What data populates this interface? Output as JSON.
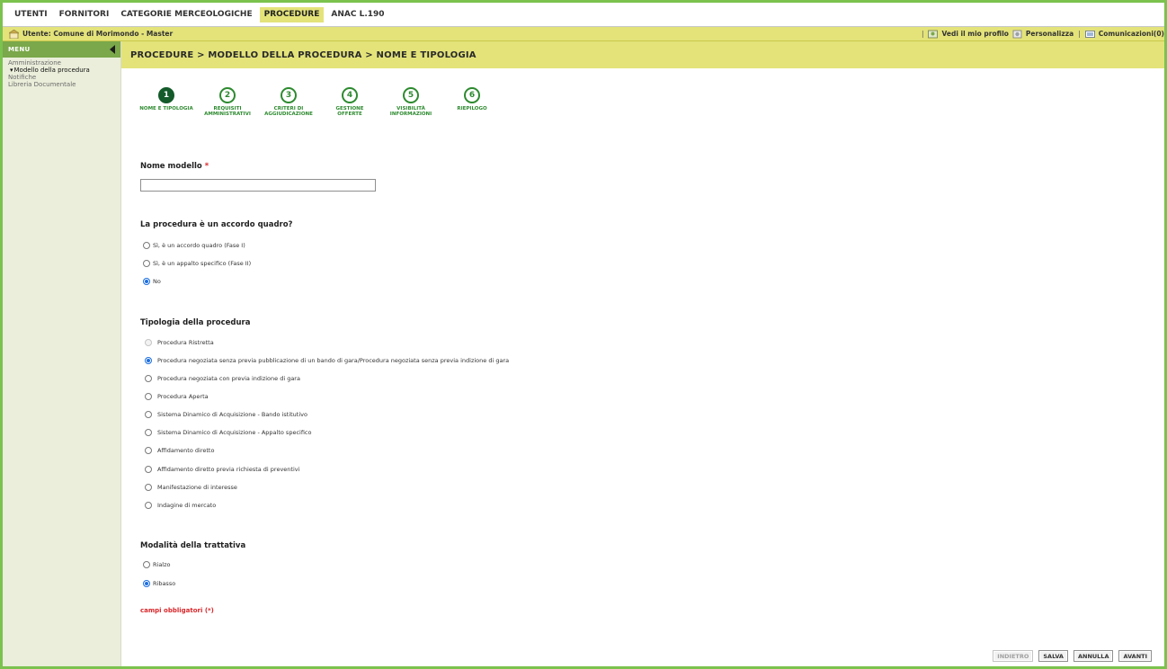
{
  "tabs": [
    {
      "label": "UTENTI",
      "active": false
    },
    {
      "label": "FORNITORI",
      "active": false
    },
    {
      "label": "CATEGORIE MERCEOLOGICHE",
      "active": false
    },
    {
      "label": "PROCEDURE",
      "active": true
    },
    {
      "label": "ANAC L.190",
      "active": false
    }
  ],
  "userbar": {
    "user_label": "Utente: Comune di Morimondo - Master",
    "profile_link": "Vedi il mio profilo",
    "customize_link": "Personalizza",
    "messages_link": "Comunicazioni(0)"
  },
  "sidebar": {
    "title": "MENU",
    "items": [
      {
        "label": "Amministrazione"
      },
      {
        "label": "Modello della procedura"
      },
      {
        "label": "Notifiche"
      },
      {
        "label": "Libreria Documentale"
      }
    ]
  },
  "breadcrumb": "PROCEDURE  > MODELLO DELLA PROCEDURA  > NOME E TIPOLOGIA",
  "steps": [
    {
      "num": "1",
      "label": "NOME E TIPOLOGIA",
      "active": true
    },
    {
      "num": "2",
      "label": "REQUISITI\nAMMINISTRATIVI",
      "active": false
    },
    {
      "num": "3",
      "label": "CRITERI DI\nAGGIUDICAZIONE",
      "active": false
    },
    {
      "num": "4",
      "label": "GESTIONE\nOFFERTE",
      "active": false
    },
    {
      "num": "5",
      "label": "VISIBILITÀ\nINFORMAZIONI",
      "active": false
    },
    {
      "num": "6",
      "label": "RIEPILOGO",
      "active": false
    }
  ],
  "form": {
    "name_label": "Nome modello",
    "required_mark": "*",
    "name_value": "",
    "framework_question": "La procedura è un accordo quadro?",
    "framework_options": [
      {
        "label": "Sì, è un accordo quadro (Fase I)",
        "selected": false
      },
      {
        "label": "Sì, è un appalto specifico (Fase II)",
        "selected": false
      },
      {
        "label": "No",
        "selected": true
      }
    ],
    "type_title": "Tipologia della procedura",
    "type_options": [
      {
        "label": "Procedura Ristretta",
        "selected": false,
        "disabled": true
      },
      {
        "label": "Procedura negoziata senza previa pubblicazione di un bando di gara/Procedura negoziata senza previa indizione di gara",
        "selected": true,
        "disabled": false
      },
      {
        "label": "Procedura negoziata con previa indizione di gara",
        "selected": false,
        "disabled": false
      },
      {
        "label": "Procedura Aperta",
        "selected": false,
        "disabled": false
      },
      {
        "label": "Sistema Dinamico di Acquisizione - Bando istitutivo",
        "selected": false,
        "disabled": false
      },
      {
        "label": "Sistema Dinamico di Acquisizione - Appalto specifico",
        "selected": false,
        "disabled": false
      },
      {
        "label": "Affidamento diretto",
        "selected": false,
        "disabled": false
      },
      {
        "label": "Affidamento diretto previa richiesta di preventivi",
        "selected": false,
        "disabled": false
      },
      {
        "label": "Manifestazione di interesse",
        "selected": false,
        "disabled": false
      },
      {
        "label": "Indagine di mercato",
        "selected": false,
        "disabled": false
      }
    ],
    "mode_title": "Modalità della trattativa",
    "mode_options": [
      {
        "label": "Rialzo",
        "selected": false
      },
      {
        "label": "Ribasso",
        "selected": true
      }
    ],
    "mandatory_note": "campi obbligatori (*)"
  },
  "buttons": {
    "back": "INDIETRO",
    "save": "SALVA",
    "cancel": "ANNULLA",
    "next": "AVANTI"
  },
  "colors": {
    "frame_green": "#7bc24e",
    "header_yellow": "#e3e37a",
    "step_green": "#2d8a2f",
    "step_active": "#145a2a",
    "required_red": "#d9262a",
    "radio_blue": "#1d6fe0"
  }
}
